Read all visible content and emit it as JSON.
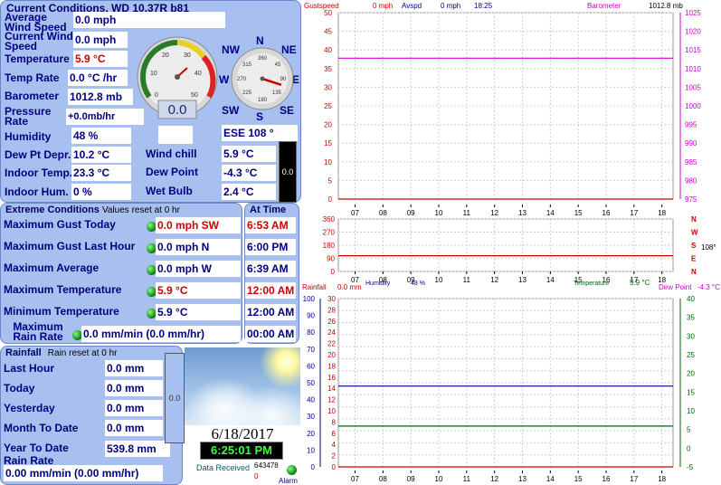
{
  "current": {
    "title": "Current Conditions, WD 10.37R b81",
    "avg_wind_label": "Average Wind Speed",
    "avg_wind": "0.0 mph",
    "cur_wind_label": "Current Wind Speed",
    "cur_wind": "0.0 mph",
    "temp_label": "Temperature",
    "temp": "5.9 °C",
    "temp_rate_label": "Temp Rate",
    "temp_rate": "0.0 °C /hr",
    "baro_label": "Barometer",
    "baro": "1012.8 mb",
    "pres_rate_label": "Pressure Rate",
    "pres_rate": "+0.0mb/hr",
    "humidity_label": "Humidity",
    "humidity": "48 %",
    "dewdep_label": "Dew Pt Depr.",
    "dewdep": "10.2 °C",
    "indoor_temp_label": "Indoor Temp.",
    "indoor_temp": "23.3 °C",
    "indoor_hum_label": "Indoor Hum.",
    "indoor_hum": "0 %",
    "windchill_label": "Wind chill",
    "windchill": "5.9 °C",
    "dewpoint_label": "Dew Point",
    "dewpoint": "-4.3 °C",
    "wetbulb_label": "Wet Bulb",
    "wetbulb": "2.4 °C",
    "wind_dir": "ESE  108 °",
    "gauge_value": "0.0",
    "gauge_ticks": [
      "0",
      "10",
      "20",
      "30",
      "40",
      "50"
    ],
    "compass_labels": {
      "n": "N",
      "ne": "NE",
      "e": "E",
      "se": "SE",
      "s": "S",
      "sw": "SW",
      "w": "W",
      "nw": "NW"
    },
    "compass_ticks": [
      "360",
      "45",
      "90",
      "135",
      "180",
      "225",
      "270",
      "315"
    ],
    "rain_bar_value": "0.0",
    "wind_dir_degrees": 108
  },
  "extreme": {
    "title": "Extreme Conditions",
    "subtitle": "Values reset at 0 hr",
    "at_time": "At Time",
    "rows": [
      {
        "label": "Maximum Gust Today",
        "value": "0.0 mph SW",
        "time": "6:53 AM",
        "red": true
      },
      {
        "label": "Maximum Gust Last Hour",
        "value": "0.0 mph  N",
        "time": "6:00 PM",
        "red": false
      },
      {
        "label": "Maximum Average",
        "value": "0.0 mph W",
        "time": "6:39 AM",
        "red": false
      },
      {
        "label": "Maximum Temperature",
        "value": "5.9 °C",
        "time": "12:00 AM",
        "red": true
      },
      {
        "label": "Minimum Temperature",
        "value": "5.9 °C",
        "time": "12:00 AM",
        "red": false
      },
      {
        "label": "Maximum Rain Rate",
        "value": "0.0 mm/min (0.0 mm/hr)",
        "time": "00:00 AM",
        "red": false
      }
    ]
  },
  "rainfall": {
    "title": "Rainfall",
    "subtitle": "Rain reset at 0 hr",
    "last_hour_label": "Last Hour",
    "last_hour": "0.0 mm",
    "today_label": "Today",
    "today": "0.0 mm",
    "yesterday_label": "Yesterday",
    "yesterday": "0.0 mm",
    "month_label": "Month To Date",
    "month": "0.0 mm",
    "year_label": "Year To Date",
    "year": "539.8 mm",
    "rate_label": "Rain Rate",
    "rate": "0.00 mm/min (0.00 mm/hr)",
    "bar_value": "0.0"
  },
  "status": {
    "date": "6/18/2017",
    "time": "6:25:01 PM",
    "data_received_label": "Data Received",
    "data_received": "643478",
    "zero": "0",
    "alarm_label": "Alarm"
  },
  "colors": {
    "panel": "#a8c0f0",
    "gust": "#cc0000",
    "baro": "#cc00cc",
    "temp": "#006600",
    "rain": "#0000cc"
  },
  "chart_data": [
    {
      "type": "line",
      "header": {
        "gust_label": "Gustspeed",
        "gust_val": "0 mph",
        "avg_label": "Avspd",
        "avg_val": "0 mph",
        "time": "18:25",
        "baro_label": "Barometer",
        "baro_val": "1012.8 mb"
      },
      "x_ticks": [
        "07",
        "08",
        "09",
        "10",
        "11",
        "12",
        "13",
        "14",
        "15",
        "16",
        "17",
        "18"
      ],
      "y_left_ticks": [
        0,
        5,
        10,
        15,
        20,
        25,
        30,
        35,
        40,
        45,
        50
      ],
      "y_right_ticks": [
        975,
        980,
        985,
        990,
        995,
        1000,
        1005,
        1010,
        1015,
        1020,
        1025
      ],
      "ylim_left": [
        0,
        50
      ],
      "ylim_right": [
        975,
        1025
      ],
      "series": [
        {
          "name": "Gustspeed",
          "color": "#cc0000",
          "axis": "left",
          "values": [
            0,
            0,
            0,
            0,
            0,
            0,
            0,
            0,
            0,
            0,
            0,
            0
          ]
        },
        {
          "name": "Barometer",
          "color": "#cc00cc",
          "axis": "right",
          "values": [
            1012.8,
            1012.8,
            1012.8,
            1012.8,
            1012.8,
            1012.8,
            1012.8,
            1012.8,
            1012.8,
            1012.8,
            1012.8,
            1012.8
          ]
        }
      ]
    },
    {
      "type": "line",
      "x_ticks": [
        "07",
        "08",
        "09",
        "10",
        "11",
        "12",
        "13",
        "14",
        "15",
        "16",
        "17",
        "18"
      ],
      "y_left_ticks": [
        0,
        90,
        180,
        270,
        360
      ],
      "ylim_left": [
        0,
        360
      ],
      "right_labels": [
        "N",
        "W",
        "S",
        "E",
        "N"
      ],
      "dir_value": "108°",
      "series": [
        {
          "name": "Wind Direction",
          "color": "#cc0000",
          "axis": "left",
          "values": [
            108,
            108,
            108,
            108,
            108,
            108,
            108,
            108,
            108,
            108,
            108,
            108
          ]
        }
      ]
    },
    {
      "type": "line",
      "header": {
        "rain_label": "Rainfall",
        "rain_val": "0.0 mm",
        "hum_label": "Humidity",
        "hum_val": "48 %",
        "temp_label": "Temperature",
        "temp_val": "5.9 °C",
        "dew_label": "Dew Point",
        "dew_val": "-4.3 °C"
      },
      "x_ticks": [
        "07",
        "08",
        "09",
        "10",
        "11",
        "12",
        "13",
        "14",
        "15",
        "16",
        "17",
        "18"
      ],
      "y_left_ticks": [
        0,
        10,
        20,
        30,
        40,
        50,
        60,
        70,
        80,
        90,
        100
      ],
      "y_mid_ticks": [
        0,
        2,
        4,
        6,
        8,
        10,
        12,
        14,
        16,
        18,
        20,
        22,
        24,
        26,
        28,
        30
      ],
      "y_right_ticks": [
        -5,
        0,
        5,
        10,
        15,
        20,
        25,
        30,
        35,
        40
      ],
      "ylim_left": [
        0,
        100
      ],
      "ylim_mid": [
        0,
        30
      ],
      "ylim_right": [
        -5,
        40
      ],
      "series": [
        {
          "name": "Rainfall",
          "color": "#cc0000",
          "axis": "mid",
          "values": [
            0,
            0,
            0,
            0,
            0,
            0,
            0,
            0,
            0,
            0,
            0,
            0
          ]
        },
        {
          "name": "Humidity",
          "color": "#000080",
          "axis": "left",
          "values": [
            48,
            48,
            48,
            48,
            48,
            48,
            48,
            48,
            48,
            48,
            48,
            48
          ]
        },
        {
          "name": "Temperature",
          "color": "#006600",
          "axis": "right",
          "values": [
            5.9,
            5.9,
            5.9,
            5.9,
            5.9,
            5.9,
            5.9,
            5.9,
            5.9,
            5.9,
            5.9,
            5.9
          ]
        }
      ]
    }
  ]
}
